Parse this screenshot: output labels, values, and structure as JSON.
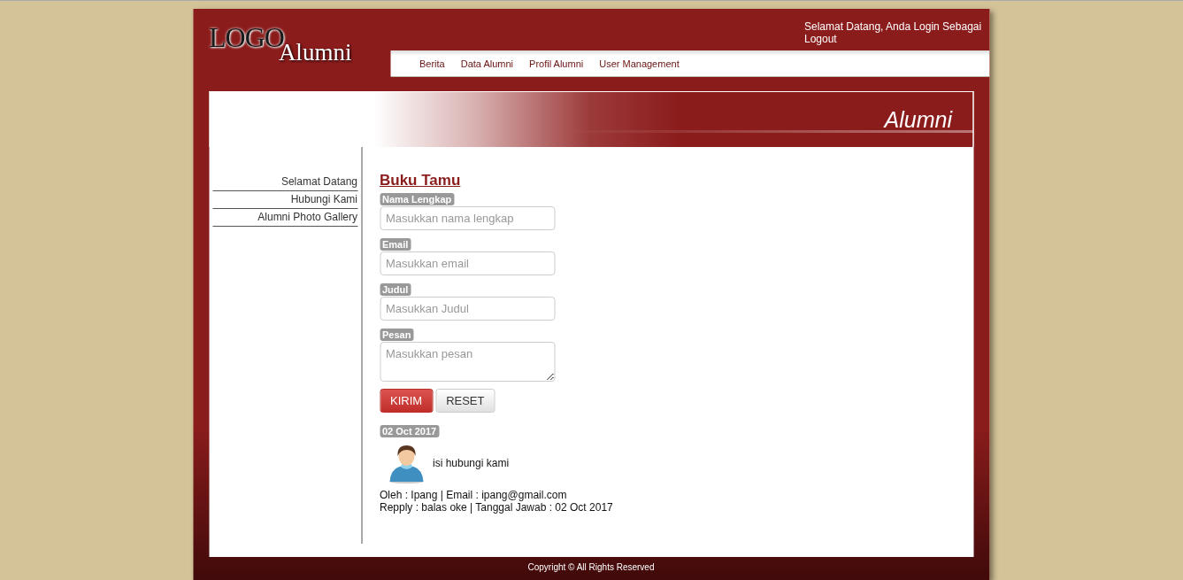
{
  "header": {
    "logo": "LOGO",
    "logo_sub": "Alumni",
    "welcome": "Selamat Datang, Anda Login Sebagai",
    "logout": "Logout"
  },
  "nav": [
    {
      "label": "Berita"
    },
    {
      "label": "Data Alumni"
    },
    {
      "label": "Profil Alumni"
    },
    {
      "label": "User Management"
    }
  ],
  "banner": {
    "title": "Alumni"
  },
  "sidebar": {
    "items": [
      {
        "label": "Selamat Datang"
      },
      {
        "label": "Hubungi Kami"
      },
      {
        "label": "Alumni Photo Gallery"
      }
    ]
  },
  "form": {
    "title": "Buku Tamu",
    "fields": [
      {
        "kind": "input",
        "label": "Nama Lengkap",
        "placeholder": "Masukkan nama lengkap"
      },
      {
        "kind": "input",
        "label": "Email",
        "placeholder": "Masukkan email"
      },
      {
        "kind": "input",
        "label": "Judul",
        "placeholder": "Masukkan Judul"
      },
      {
        "kind": "textarea",
        "label": "Pesan",
        "placeholder": "Masukkan pesan"
      }
    ],
    "buttons": [
      {
        "kind": "primary",
        "label": "KIRIM"
      },
      {
        "kind": "default",
        "label": "RESET"
      }
    ]
  },
  "entries": [
    {
      "date": "02 Oct 2017",
      "message": "isi hubungi kami",
      "meta": "Oleh : Ipang | Email : ipang@gmail.com",
      "reply": "Repply : balas oke | Tanggal Jawab : 02 Oct 2017"
    }
  ],
  "footer": {
    "copyright": "Copyright © All Rights Reserved"
  }
}
